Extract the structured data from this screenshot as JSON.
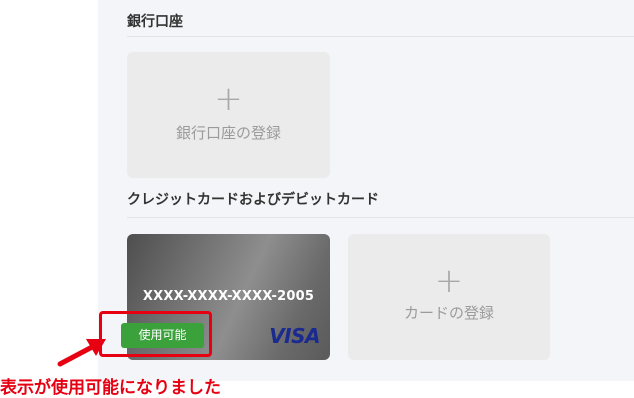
{
  "bank_section": {
    "title": "銀行口座",
    "add_plus": "+",
    "add_label": "銀行口座の登録"
  },
  "card_section": {
    "title": "クレジットカードおよびデビットカード",
    "card": {
      "number": "XXXX-XXXX-XXXX-2005",
      "brand": "VISA",
      "status_badge": "使用可能"
    },
    "add_plus": "+",
    "add_label": "カードの登録"
  },
  "annotation": {
    "text": "表示が使用可能になりました",
    "color": "#e60012"
  },
  "colors": {
    "badge_green": "#3aa13b",
    "visa_blue": "#1a2a8f",
    "panel_bg": "#f4f5f8"
  },
  "icons": {
    "add": "plus-icon",
    "arrow": "arrow-icon"
  }
}
